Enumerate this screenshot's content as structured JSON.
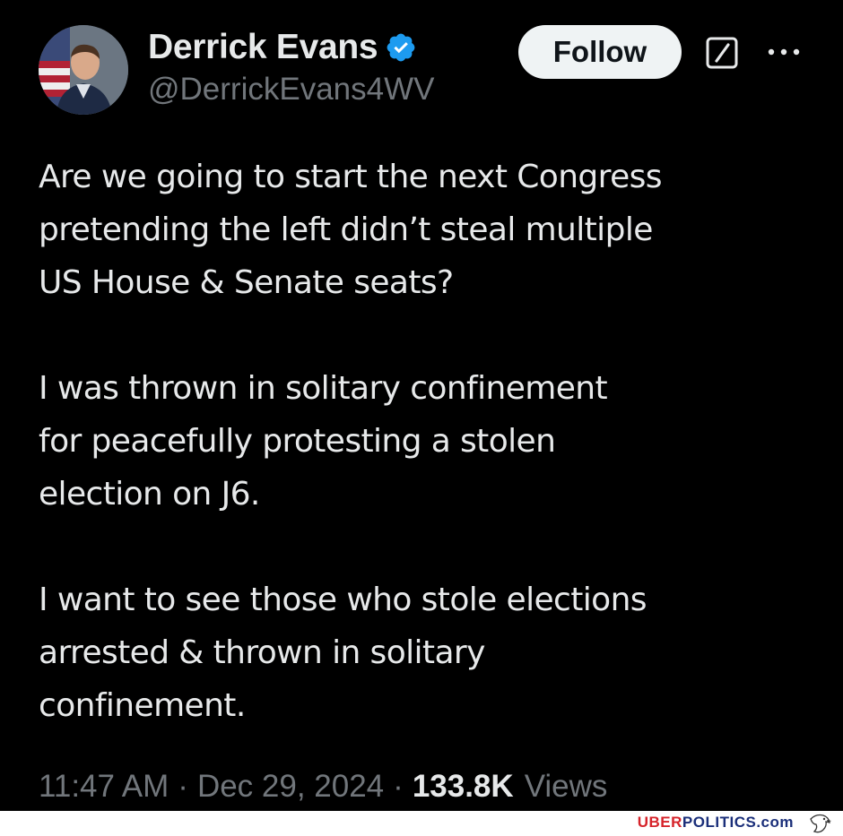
{
  "user": {
    "display_name": "Derrick Evans",
    "handle": "@DerrickEvans4WV",
    "verified_icon": "verified-badge-icon",
    "verified_color": "#1d9bf0"
  },
  "actions": {
    "follow_label": "Follow",
    "grok_icon": "grok-icon",
    "more_icon": "more-options-icon"
  },
  "tweet": {
    "paragraphs": [
      "Are we going to start the next Congress\npretending the left didn’t steal multiple\nUS House & Senate seats?",
      "I was thrown in solitary confinement\nfor peacefully protesting a stolen\nelection on J6.",
      "I want to see those who stole elections\narrested & thrown in solitary\nconfinement."
    ],
    "time": "11:47 AM",
    "date": "Dec 29, 2024",
    "separator": "·",
    "views_count": "133.8K",
    "views_label": "Views"
  },
  "watermark": {
    "site_part1": "UBER",
    "site_part2": "POLITICS.com",
    "logo_icon": "eagle-icon"
  },
  "colors": {
    "background": "#000000",
    "text": "#e7e9ea",
    "secondary_text": "#71767b",
    "follow_bg": "#eff3f4"
  }
}
